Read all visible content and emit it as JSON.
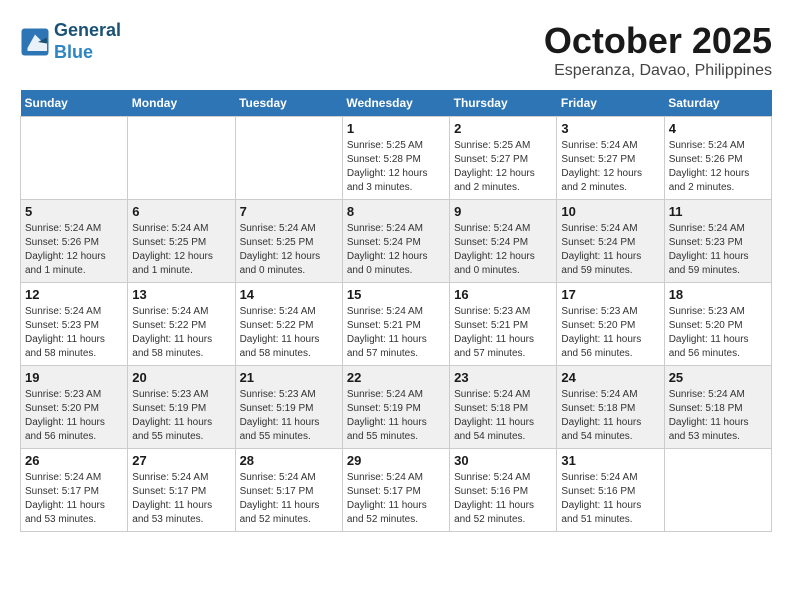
{
  "header": {
    "logo_line1": "General",
    "logo_line2": "Blue",
    "month": "October 2025",
    "location": "Esperanza, Davao, Philippines"
  },
  "weekdays": [
    "Sunday",
    "Monday",
    "Tuesday",
    "Wednesday",
    "Thursday",
    "Friday",
    "Saturday"
  ],
  "weeks": [
    [
      {
        "day": "",
        "info": ""
      },
      {
        "day": "",
        "info": ""
      },
      {
        "day": "",
        "info": ""
      },
      {
        "day": "1",
        "info": "Sunrise: 5:25 AM\nSunset: 5:28 PM\nDaylight: 12 hours\nand 3 minutes."
      },
      {
        "day": "2",
        "info": "Sunrise: 5:25 AM\nSunset: 5:27 PM\nDaylight: 12 hours\nand 2 minutes."
      },
      {
        "day": "3",
        "info": "Sunrise: 5:24 AM\nSunset: 5:27 PM\nDaylight: 12 hours\nand 2 minutes."
      },
      {
        "day": "4",
        "info": "Sunrise: 5:24 AM\nSunset: 5:26 PM\nDaylight: 12 hours\nand 2 minutes."
      }
    ],
    [
      {
        "day": "5",
        "info": "Sunrise: 5:24 AM\nSunset: 5:26 PM\nDaylight: 12 hours\nand 1 minute."
      },
      {
        "day": "6",
        "info": "Sunrise: 5:24 AM\nSunset: 5:25 PM\nDaylight: 12 hours\nand 1 minute."
      },
      {
        "day": "7",
        "info": "Sunrise: 5:24 AM\nSunset: 5:25 PM\nDaylight: 12 hours\nand 0 minutes."
      },
      {
        "day": "8",
        "info": "Sunrise: 5:24 AM\nSunset: 5:24 PM\nDaylight: 12 hours\nand 0 minutes."
      },
      {
        "day": "9",
        "info": "Sunrise: 5:24 AM\nSunset: 5:24 PM\nDaylight: 12 hours\nand 0 minutes."
      },
      {
        "day": "10",
        "info": "Sunrise: 5:24 AM\nSunset: 5:24 PM\nDaylight: 11 hours\nand 59 minutes."
      },
      {
        "day": "11",
        "info": "Sunrise: 5:24 AM\nSunset: 5:23 PM\nDaylight: 11 hours\nand 59 minutes."
      }
    ],
    [
      {
        "day": "12",
        "info": "Sunrise: 5:24 AM\nSunset: 5:23 PM\nDaylight: 11 hours\nand 58 minutes."
      },
      {
        "day": "13",
        "info": "Sunrise: 5:24 AM\nSunset: 5:22 PM\nDaylight: 11 hours\nand 58 minutes."
      },
      {
        "day": "14",
        "info": "Sunrise: 5:24 AM\nSunset: 5:22 PM\nDaylight: 11 hours\nand 58 minutes."
      },
      {
        "day": "15",
        "info": "Sunrise: 5:24 AM\nSunset: 5:21 PM\nDaylight: 11 hours\nand 57 minutes."
      },
      {
        "day": "16",
        "info": "Sunrise: 5:23 AM\nSunset: 5:21 PM\nDaylight: 11 hours\nand 57 minutes."
      },
      {
        "day": "17",
        "info": "Sunrise: 5:23 AM\nSunset: 5:20 PM\nDaylight: 11 hours\nand 56 minutes."
      },
      {
        "day": "18",
        "info": "Sunrise: 5:23 AM\nSunset: 5:20 PM\nDaylight: 11 hours\nand 56 minutes."
      }
    ],
    [
      {
        "day": "19",
        "info": "Sunrise: 5:23 AM\nSunset: 5:20 PM\nDaylight: 11 hours\nand 56 minutes."
      },
      {
        "day": "20",
        "info": "Sunrise: 5:23 AM\nSunset: 5:19 PM\nDaylight: 11 hours\nand 55 minutes."
      },
      {
        "day": "21",
        "info": "Sunrise: 5:23 AM\nSunset: 5:19 PM\nDaylight: 11 hours\nand 55 minutes."
      },
      {
        "day": "22",
        "info": "Sunrise: 5:24 AM\nSunset: 5:19 PM\nDaylight: 11 hours\nand 55 minutes."
      },
      {
        "day": "23",
        "info": "Sunrise: 5:24 AM\nSunset: 5:18 PM\nDaylight: 11 hours\nand 54 minutes."
      },
      {
        "day": "24",
        "info": "Sunrise: 5:24 AM\nSunset: 5:18 PM\nDaylight: 11 hours\nand 54 minutes."
      },
      {
        "day": "25",
        "info": "Sunrise: 5:24 AM\nSunset: 5:18 PM\nDaylight: 11 hours\nand 53 minutes."
      }
    ],
    [
      {
        "day": "26",
        "info": "Sunrise: 5:24 AM\nSunset: 5:17 PM\nDaylight: 11 hours\nand 53 minutes."
      },
      {
        "day": "27",
        "info": "Sunrise: 5:24 AM\nSunset: 5:17 PM\nDaylight: 11 hours\nand 53 minutes."
      },
      {
        "day": "28",
        "info": "Sunrise: 5:24 AM\nSunset: 5:17 PM\nDaylight: 11 hours\nand 52 minutes."
      },
      {
        "day": "29",
        "info": "Sunrise: 5:24 AM\nSunset: 5:17 PM\nDaylight: 11 hours\nand 52 minutes."
      },
      {
        "day": "30",
        "info": "Sunrise: 5:24 AM\nSunset: 5:16 PM\nDaylight: 11 hours\nand 52 minutes."
      },
      {
        "day": "31",
        "info": "Sunrise: 5:24 AM\nSunset: 5:16 PM\nDaylight: 11 hours\nand 51 minutes."
      },
      {
        "day": "",
        "info": ""
      }
    ]
  ]
}
